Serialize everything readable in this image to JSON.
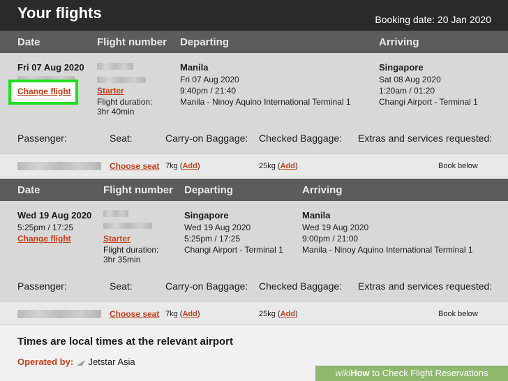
{
  "header": {
    "title": "Your flights",
    "booking_label": "Booking date:",
    "booking_date": "20 Jan 2020"
  },
  "columns": {
    "date": "Date",
    "flight_number": "Flight number",
    "departing": "Departing",
    "arriving": "Arriving"
  },
  "outbound": {
    "date": "Fri 07 Aug 2020",
    "change_link": "Change flight",
    "fare": "Starter",
    "duration_label": "Flight duration:",
    "duration": "3hr 40min",
    "dep_city": "Manila",
    "dep_date": "Fri 07 Aug 2020",
    "dep_time": "9:40pm / 21:40",
    "dep_airport": "Manila - Ninoy Aquino International Terminal 1",
    "arr_city": "Singapore",
    "arr_date": "Sat 08 Aug 2020",
    "arr_time": "1:20am / 01:20",
    "arr_airport": "Changi Airport - Terminal 1"
  },
  "passenger_labels": {
    "passenger": "Passenger:",
    "seat": "Seat:",
    "carry_on": "Carry-on Baggage:",
    "checked": "Checked Baggage:",
    "extras": "Extras and services requested:"
  },
  "outbound_passenger": {
    "choose_seat": "Choose seat",
    "carry_kg": "7kg",
    "checked_kg": "25kg",
    "add": "Add",
    "extras": "Book below"
  },
  "return": {
    "date": "Wed 19 Aug 2020",
    "time": "5:25pm / 17:25",
    "change_link": "Change flight",
    "fare": "Starter",
    "duration_label": "Flight duration:",
    "duration": "3hr 35min",
    "dep_city": "Singapore",
    "dep_date": "Wed 19 Aug 2020",
    "dep_time": "5:25pm / 17:25",
    "dep_airport": "Changi Airport - Terminal 1",
    "arr_city": "Manila",
    "arr_date": "Wed 19 Aug 2020",
    "arr_time": "9:00pm / 21:00",
    "arr_airport": "Manila - Ninoy Aquino International Terminal 1"
  },
  "return_passenger": {
    "choose_seat": "Choose seat",
    "carry_kg": "7kg",
    "checked_kg": "25kg",
    "add": "Add",
    "extras": "Book below"
  },
  "footer": {
    "note": "Times are local times at the relevant airport",
    "operated_label": "Operated by:",
    "airline": "Jetstar Asia"
  },
  "watermark": {
    "wiki": "wiki",
    "how": "How",
    "rest": " to Check Flight Reservations"
  },
  "colors": {
    "accent": "#c4411a",
    "highlight": "#1ee01e",
    "header_bar": "#5c5c5c",
    "topbar": "#2a2a2a"
  }
}
